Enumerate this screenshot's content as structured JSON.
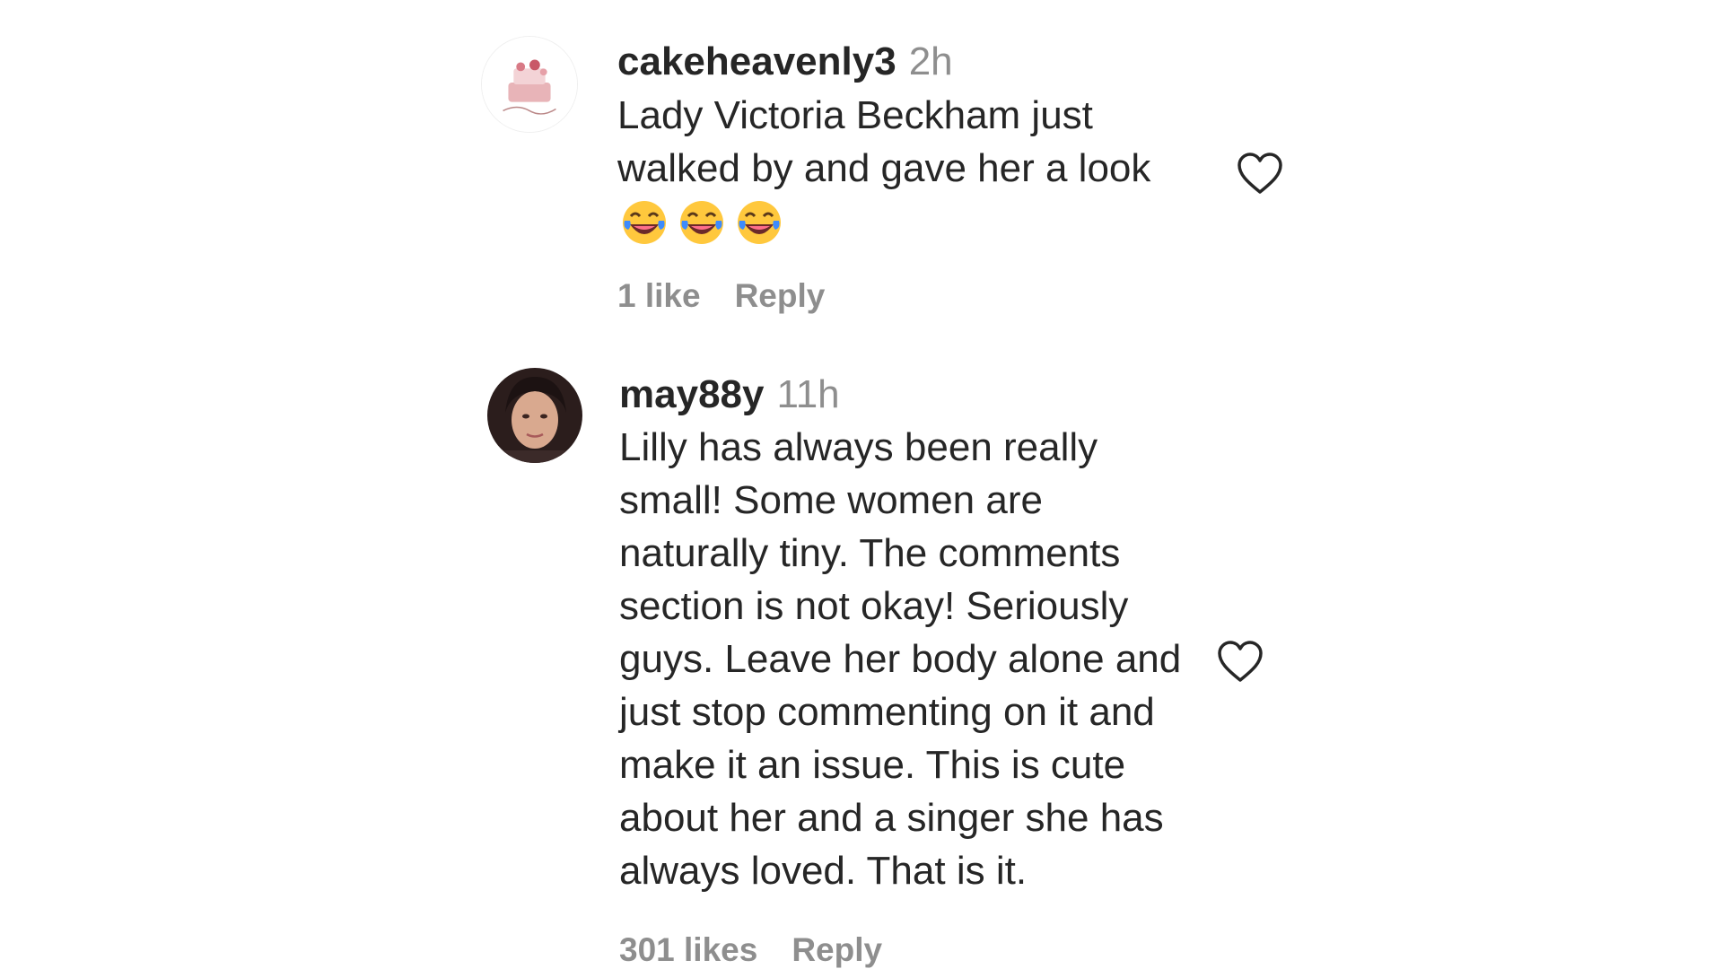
{
  "comments": [
    {
      "username": "cakeheavenly3",
      "time": "2h",
      "text_lines": [
        "Lady Victoria Beckham just",
        "walked by and gave her a look"
      ],
      "emoji_icons": [
        "face-with-tears-of-joy-icon",
        "face-with-tears-of-joy-icon",
        "face-with-tears-of-joy-icon"
      ],
      "likes": "1 like",
      "reply_label": "Reply",
      "avatar_icon": "cake-avatar",
      "like_icon": "heart-outline-icon"
    },
    {
      "username": "may88y",
      "time": "11h",
      "text_lines": [
        "Lilly has always been really",
        "small! Some women are",
        "naturally tiny. The comments",
        "section is not okay! Seriously",
        "guys. Leave her body alone and",
        "just stop commenting on it and",
        "make it an issue. This is cute",
        "about her and a singer she has",
        "always loved. That is it."
      ],
      "likes": "301 likes",
      "reply_label": "Reply",
      "avatar_icon": "profile-photo-avatar",
      "like_icon": "heart-outline-icon"
    }
  ]
}
